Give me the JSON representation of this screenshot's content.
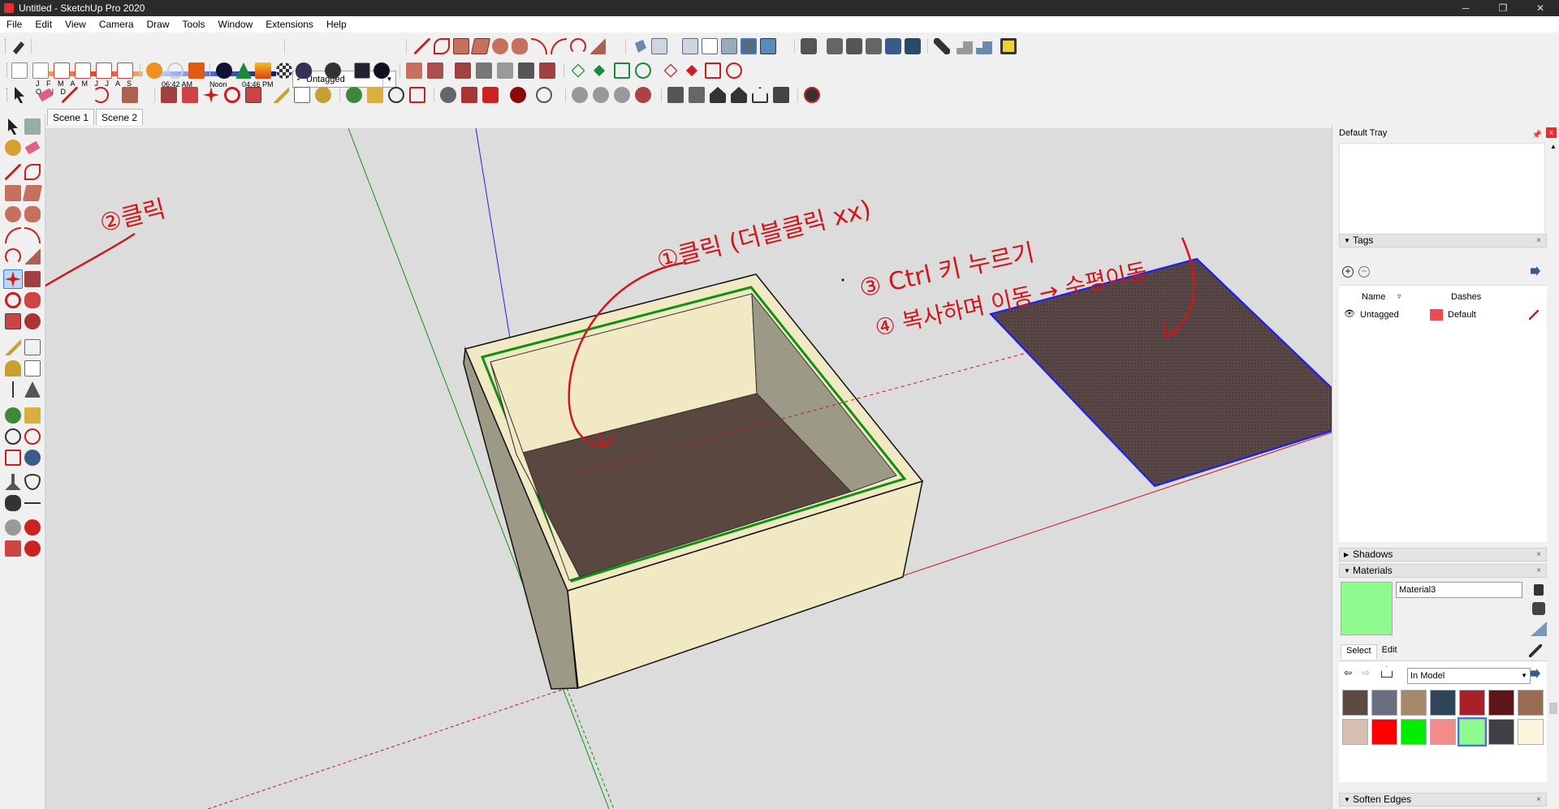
{
  "window": {
    "title": "Untitled - SketchUp Pro 2020",
    "controls": {
      "minimize": "─",
      "maximize": "❐",
      "close": "✕"
    }
  },
  "menu": [
    "File",
    "Edit",
    "View",
    "Camera",
    "Draw",
    "Tools",
    "Window",
    "Extensions",
    "Help"
  ],
  "shadows": {
    "months": "J F M A M J J A S O N D",
    "time_start": "06:42 AM",
    "time_noon": "Noon",
    "time_end": "04:46 PM"
  },
  "tag_dropdown": {
    "check": "✓",
    "value": "Untagged",
    "arrow": "▼"
  },
  "scenes": [
    "Scene 1",
    "Scene 2"
  ],
  "annotations": {
    "step1": "①클릭 (더블클릭 xx)",
    "step2": "②클릭",
    "step3": "③ Ctrl 키 누르기",
    "step4": "④ 복사하며 이동 → 수평이동"
  },
  "tray": {
    "title": "Default Tray",
    "pin": "📌",
    "close": "x",
    "tags": {
      "title": "Tags",
      "col_name": "Name",
      "col_dashes": "Dashes",
      "row_name": "Untagged",
      "row_dashes": "Default"
    },
    "shadows_title": "Shadows",
    "materials": {
      "title": "Materials",
      "name": "Material3",
      "tab_select": "Select",
      "tab_edit": "Edit",
      "library": "In Model",
      "swatches": [
        "#5a4a42",
        "#6b6e7e",
        "#a58a6a",
        "#2f4658",
        "#a8202a",
        "#5e1518",
        "#9a6a52",
        "#d6bfb2",
        "#ff0000",
        "#00ee00",
        "#f58c8c",
        "#8dfb8e",
        "#3f4046",
        "#fdf5dd"
      ],
      "selected_index": 11
    },
    "soften_edges_title": "Soften Edges",
    "panel_triangle_open": "▼",
    "panel_triangle_closed": "▶",
    "panel_close": "×"
  },
  "colors": {
    "annotation_red": "#d0161b",
    "box_face": "#f1e8c4",
    "box_inner_side": "#9c9a86",
    "box_floor": "#5a4740",
    "axis_red": "#c01818",
    "axis_green": "#109010",
    "axis_blue": "#2424c8",
    "selection_blue": "#1a1aff",
    "viewport_bg": "#dcdcdc"
  }
}
